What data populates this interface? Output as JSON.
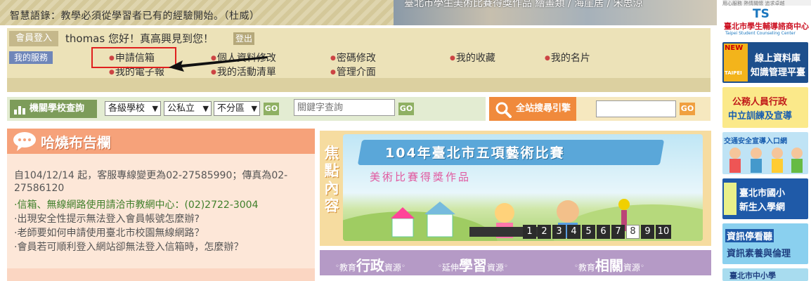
{
  "top": {
    "motto": "智慧語錄：教學必須從學習者已有的經驗開始。（杜威）",
    "banner_caption": "臺北市學生美術比賽得獎作品 繪畫類 / 海崖居 / 宋思涼"
  },
  "member": {
    "login_tab": "會員登入",
    "greeting": "thomas 您好！真高興見到您！",
    "logout": "登出",
    "my_service": "我的服務",
    "links": [
      {
        "label": "申請信箱"
      },
      {
        "label": "個人資料修改"
      },
      {
        "label": "密碼修改"
      },
      {
        "label": "我的收藏"
      },
      {
        "label": "我的名片"
      },
      {
        "label": "我的電子報"
      },
      {
        "label": "我的活動清單"
      },
      {
        "label": "管理介面"
      }
    ],
    "highlight_color": "#e0201e"
  },
  "search": {
    "label": "機關學校查詢",
    "school_level": "各級學校",
    "public_private": "公私立",
    "district": "不分區",
    "go": "GO",
    "keyword_placeholder": "關鍵字查詢"
  },
  "site_search": {
    "label": "全站搜尋引擎",
    "go": "GO"
  },
  "bulletin": {
    "title": "哈燒布告欄",
    "notices": [
      "自104/12/14 起，客服專線變更為02-27585990；傳真為02-27586120",
      "·信箱、無線網路使用請洽市教網中心：(02)2722-3004",
      "·出現安全性提示無法登入會員帳號怎麼辦?",
      "·老師要如何申請使用臺北市校園無線網路？",
      "·會員若可順利登入網站卻無法登入信箱時，怎麼辦？"
    ]
  },
  "focus": {
    "label": "焦點內容",
    "banner_title": "104年臺北市五項藝術比賽",
    "banner_subtitle": "美術比賽得獎作品",
    "pages": [
      "1",
      "2",
      "3",
      "4",
      "5",
      "6",
      "7",
      "8",
      "9",
      "10"
    ],
    "active_page": 8
  },
  "resources": [
    {
      "pre": "教育",
      "big": "行政",
      "post": "資源"
    },
    {
      "pre": "延伸",
      "big": "學習",
      "post": "資源"
    },
    {
      "pre": "教育",
      "big": "相關",
      "post": "資源"
    }
  ],
  "right_column": {
    "top_text": "用心服務 熱情關懷 追求卓越",
    "logo_mark": "TS",
    "logo_name": "臺北市學生輔導諮商中心",
    "logo_en": "Taipei Student Counseling Center",
    "banners": [
      {
        "line1": "線上資料庫",
        "line2": "知識管理平臺",
        "badge": "NEW",
        "badge2": "TAIPEI"
      },
      {
        "line1": "公務人員行政",
        "line2": "中立訓練及宣導"
      },
      {
        "line1": "交通安全宣導入口網",
        "line2": ""
      },
      {
        "line1": "臺北市國小",
        "line2": "新生入學網"
      },
      {
        "line1": "資訊停看聽",
        "line2": "資訊素養與倫理"
      },
      {
        "line1": "臺北市中小學",
        "line2": ""
      }
    ]
  },
  "colors": {
    "member_bg": "#ece2b8",
    "search_green": "#7d9c5a",
    "site_search_orange": "#f08a3c",
    "bulletin_header": "#f6a27a",
    "resources_purple": "#b59ac6"
  }
}
